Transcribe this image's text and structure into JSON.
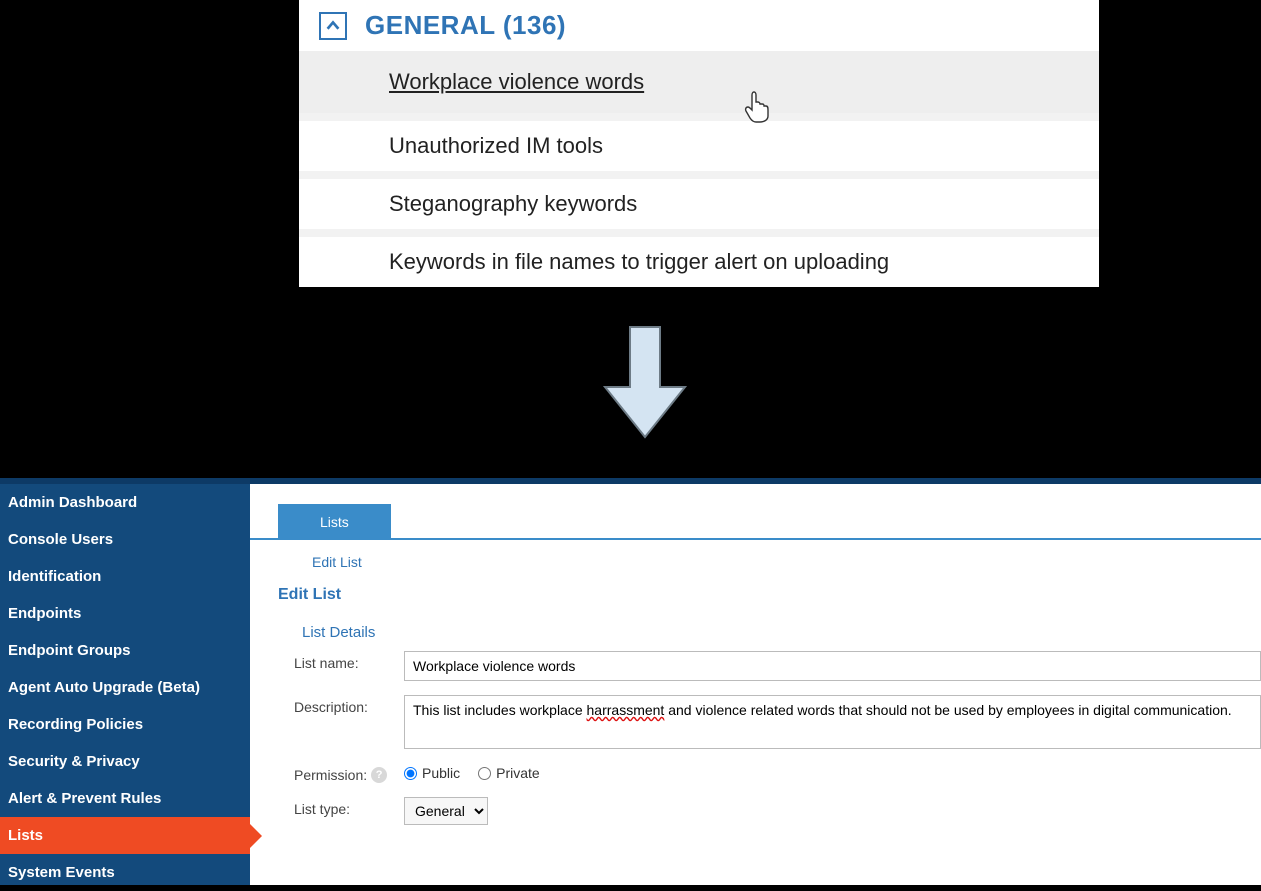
{
  "upper": {
    "section_title": "GENERAL (136)",
    "rows": [
      "Workplace violence words",
      "Unauthorized IM tools",
      "Steganography keywords",
      "Keywords in file names to trigger alert on uploading"
    ]
  },
  "sidebar": {
    "items": [
      {
        "label": "Admin Dashboard",
        "active": false
      },
      {
        "label": "Console Users",
        "active": false
      },
      {
        "label": "Identification",
        "active": false
      },
      {
        "label": "Endpoints",
        "active": false
      },
      {
        "label": "Endpoint Groups",
        "active": false
      },
      {
        "label": "Agent Auto Upgrade (Beta)",
        "active": false
      },
      {
        "label": "Recording Policies",
        "active": false
      },
      {
        "label": "Security & Privacy",
        "active": false
      },
      {
        "label": "Alert & Prevent Rules",
        "active": false
      },
      {
        "label": "Lists",
        "active": true
      },
      {
        "label": "System Events",
        "active": false
      }
    ]
  },
  "tabs": {
    "lists": "Lists"
  },
  "breadcrumb": "Edit List",
  "page_title": "Edit List",
  "section_label": "List Details",
  "form": {
    "labels": {
      "list_name": "List name:",
      "description": "Description:",
      "permission": "Permission:",
      "list_type": "List type:"
    },
    "list_name_value": "Workplace violence words",
    "description_before": "This list includes workplace ",
    "description_misspelled": "harrassment",
    "description_after": " and violence related words that should not be used by employees in digital communication.",
    "permission": {
      "public": "Public",
      "private": "Private",
      "selected": "public"
    },
    "list_type_options": [
      "General"
    ],
    "list_type_selected": "General"
  }
}
